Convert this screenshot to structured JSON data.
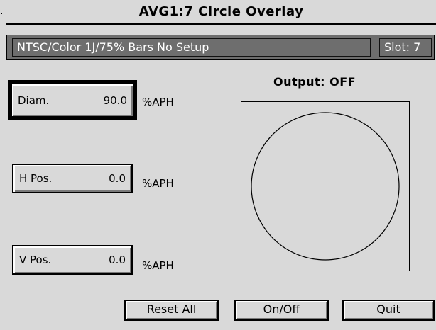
{
  "window": {
    "title": "AVG1:7  Circle Overlay"
  },
  "status": {
    "signal": "NTSC/Color 1J/75% Bars  No Setup",
    "slot": "Slot: 7"
  },
  "params": [
    {
      "label": "Diam.",
      "value": "90.0",
      "unit": "%APH",
      "selected": true
    },
    {
      "label": "H Pos.",
      "value": "0.0",
      "unit": "%APH",
      "selected": false
    },
    {
      "label": "V Pos.",
      "value": "0.0",
      "unit": "%APH",
      "selected": false
    }
  ],
  "output": {
    "label": "Output: OFF"
  },
  "buttons": {
    "reset_all": "Reset All",
    "on_off": "On/Off",
    "quit": "Quit"
  }
}
